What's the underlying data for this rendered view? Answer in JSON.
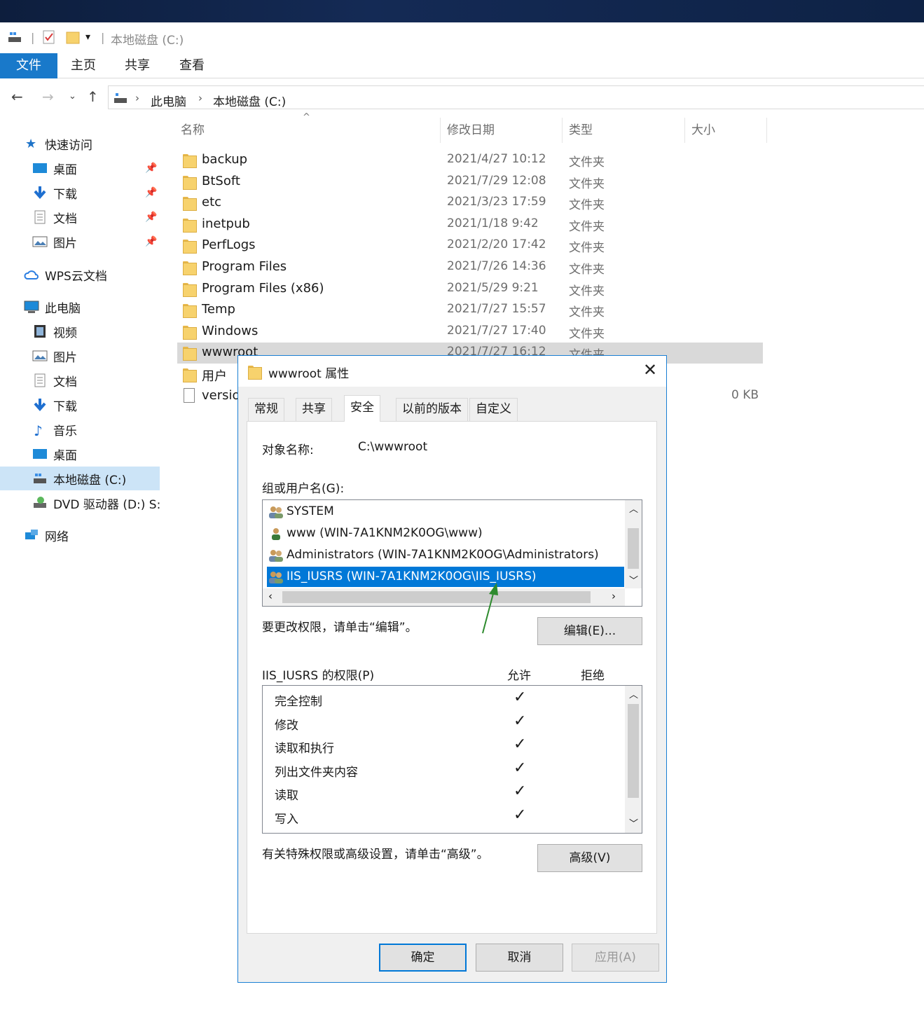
{
  "window": {
    "title": "本地磁盘 (C:)"
  },
  "ribbon": {
    "tabs": [
      "文件",
      "主页",
      "共享",
      "查看"
    ]
  },
  "address": {
    "crumbs": [
      "此电脑",
      "本地磁盘 (C:)"
    ]
  },
  "nav": {
    "quick_access": "快速访问",
    "qa_items": [
      "桌面",
      "下载",
      "文档",
      "图片"
    ],
    "wps": "WPS云文档",
    "this_pc": "此电脑",
    "pc_items": [
      "视频",
      "图片",
      "文档",
      "下载",
      "音乐",
      "桌面",
      "本地磁盘 (C:)",
      "DVD 驱动器 (D:) S:"
    ],
    "network": "网络"
  },
  "columns": {
    "name": "名称",
    "date": "修改日期",
    "type": "类型",
    "size": "大小"
  },
  "files": [
    {
      "name": "backup",
      "date": "2021/4/27 10:12",
      "type": "文件夹",
      "size": ""
    },
    {
      "name": "BtSoft",
      "date": "2021/7/29 12:08",
      "type": "文件夹",
      "size": ""
    },
    {
      "name": "etc",
      "date": "2021/3/23 17:59",
      "type": "文件夹",
      "size": ""
    },
    {
      "name": "inetpub",
      "date": "2021/1/18 9:42",
      "type": "文件夹",
      "size": ""
    },
    {
      "name": "PerfLogs",
      "date": "2021/2/20 17:42",
      "type": "文件夹",
      "size": ""
    },
    {
      "name": "Program Files",
      "date": "2021/7/26 14:36",
      "type": "文件夹",
      "size": ""
    },
    {
      "name": "Program Files (x86)",
      "date": "2021/5/29 9:21",
      "type": "文件夹",
      "size": ""
    },
    {
      "name": "Temp",
      "date": "2021/7/27 15:57",
      "type": "文件夹",
      "size": ""
    },
    {
      "name": "Windows",
      "date": "2021/7/27 17:40",
      "type": "文件夹",
      "size": ""
    },
    {
      "name": "wwwroot",
      "date": "2021/7/27 16:12",
      "type": "文件夹",
      "size": ""
    },
    {
      "name": "用户",
      "date": "",
      "type": "",
      "size": ""
    },
    {
      "name": "versio",
      "date": "",
      "type": "",
      "size": "0 KB"
    }
  ],
  "dialog": {
    "title": "wwwroot 属性",
    "tabs": [
      "常规",
      "共享",
      "安全",
      "以前的版本",
      "自定义"
    ],
    "object_label": "对象名称:",
    "object_value": "C:\\wwwroot",
    "groups_label": "组或用户名(G):",
    "users": [
      "SYSTEM",
      "www (WIN-7A1KNM2K0OG\\www)",
      "Administrators (WIN-7A1KNM2K0OG\\Administrators)",
      "IIS_IUSRS (WIN-7A1KNM2K0OG\\IIS_IUSRS)"
    ],
    "edit_hint": "要更改权限，请单击“编辑”。",
    "edit_button": "编辑(E)...",
    "perm_label": "IIS_IUSRS 的权限(P)",
    "allow": "允许",
    "deny": "拒绝",
    "permissions": [
      "完全控制",
      "修改",
      "读取和执行",
      "列出文件夹内容",
      "读取",
      "写入"
    ],
    "check": "✓",
    "advanced_hint": "有关特殊权限或高级设置，请单击“高级”。",
    "advanced_button": "高级(V)",
    "ok": "确定",
    "cancel": "取消",
    "apply": "应用(A)"
  },
  "colors": {
    "accent": "#0078d7",
    "file_tab": "#1979ca",
    "annotation": "#2e8b2e"
  }
}
